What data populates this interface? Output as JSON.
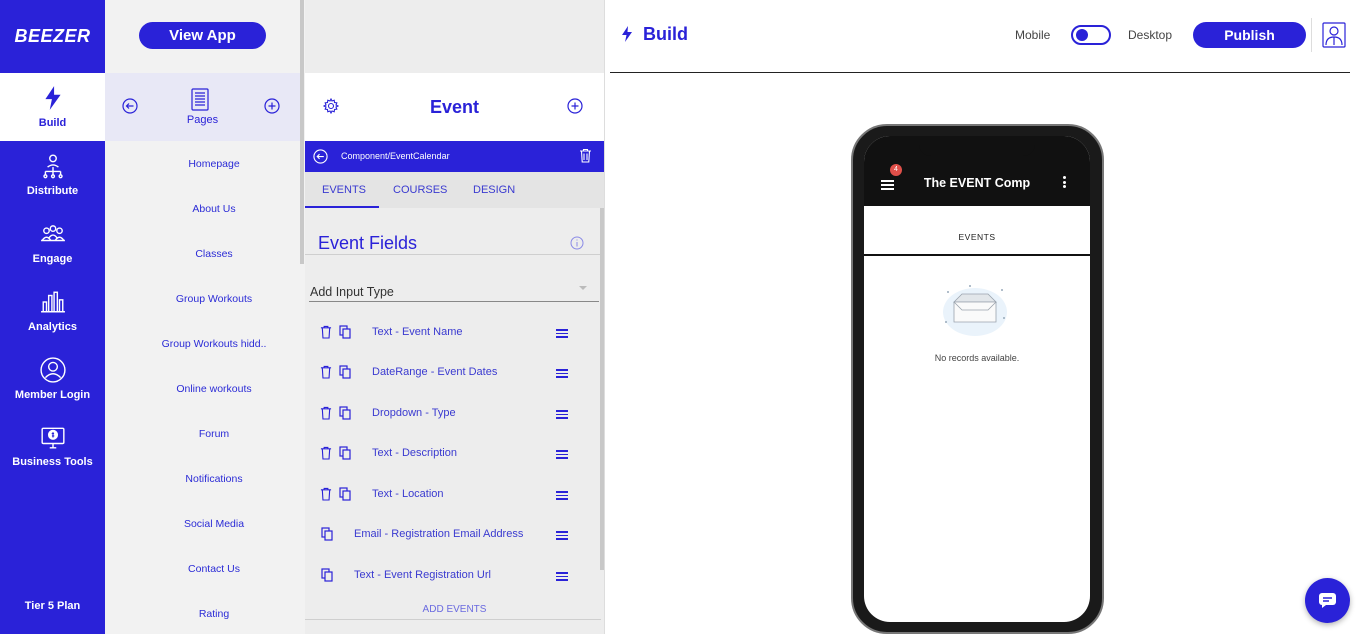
{
  "brand": {
    "logo_text": "BEEZER",
    "accent_color": "#2a22d8"
  },
  "leftnav": {
    "items": [
      {
        "label": "Build",
        "icon": "bolt-icon",
        "active": true
      },
      {
        "label": "Distribute",
        "icon": "network-icon",
        "active": false
      },
      {
        "label": "Engage",
        "icon": "people-icon",
        "active": false
      },
      {
        "label": "Analytics",
        "icon": "bar-chart-icon",
        "active": false
      },
      {
        "label": "Member Login",
        "icon": "user-circle-icon",
        "active": false
      },
      {
        "label": "Business Tools",
        "icon": "monitor-dollar-icon",
        "active": false
      }
    ],
    "tier_label": "Tier 5 Plan"
  },
  "pages": {
    "view_app_label": "View App",
    "header_label": "Pages",
    "items": [
      "Homepage",
      "About Us",
      "Classes",
      "Group Workouts",
      "Group Workouts hidd..",
      "Online workouts",
      "Forum",
      "Notifications",
      "Social Media",
      "Contact Us",
      "Rating"
    ]
  },
  "component": {
    "title": "Event",
    "path": "Component/EventCalendar",
    "tabs": [
      "EVENTS",
      "COURSES",
      "DESIGN"
    ],
    "fields_title": "Event Fields",
    "add_input_placeholder": "Add Input Type",
    "fields": [
      {
        "label": "Text - Event Name",
        "deletable": true
      },
      {
        "label": "DateRange - Event Dates",
        "deletable": true
      },
      {
        "label": "Dropdown - Type",
        "deletable": true
      },
      {
        "label": "Text - Description",
        "deletable": true
      },
      {
        "label": "Text - Location",
        "deletable": true
      },
      {
        "label": "Email - Registration Email Address",
        "deletable": false
      },
      {
        "label": "Text - Event Registration Url",
        "deletable": false
      }
    ],
    "add_events_label": "ADD EVENTS"
  },
  "header": {
    "title": "Build",
    "mobile_label": "Mobile",
    "desktop_label": "Desktop",
    "publish_label": "Publish"
  },
  "preview": {
    "badge_count": "4",
    "app_title": "The EVENT Comp",
    "section_label": "EVENTS",
    "empty_text": "No records available."
  }
}
